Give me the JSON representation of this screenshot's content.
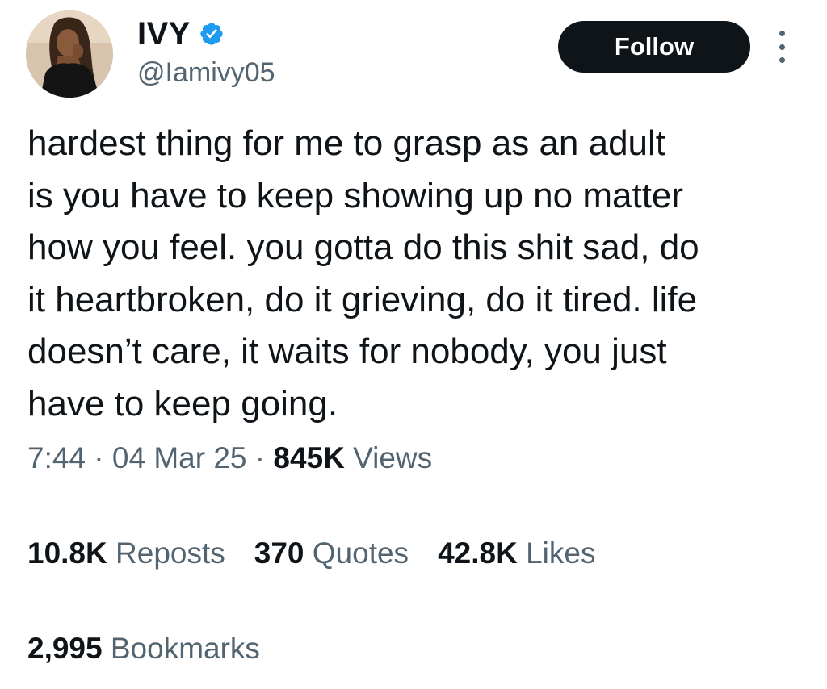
{
  "author": {
    "display_name": "IVY",
    "handle": "@Iamivy05",
    "verified_color": "#1d9bf0",
    "verified_icon": "verified-badge-icon",
    "avatar_icon": "profile-photo"
  },
  "actions": {
    "follow_label": "Follow",
    "more_icon": "more-vertical-icon"
  },
  "tweet": {
    "text": "hardest thing for me to grasp as an adult\nis you have to keep showing up no matter\nhow you feel. you gotta do this shit sad, do\nit heartbroken, do it grieving, do it tired. life\ndoesn’t care, it waits for nobody, you just\nhave to keep going."
  },
  "meta": {
    "time": "7:44",
    "separator": "·",
    "date": "04 Mar 25",
    "views_count": "845K",
    "views_label": "Views"
  },
  "stats": {
    "reposts_count": "10.8K",
    "reposts_label": "Reposts",
    "quotes_count": "370",
    "quotes_label": "Quotes",
    "likes_count": "42.8K",
    "likes_label": "Likes",
    "bookmarks_count": "2,995",
    "bookmarks_label": "Bookmarks"
  },
  "colors": {
    "text_primary": "#0f1419",
    "text_secondary": "#536471",
    "follow_bg": "#0f1419",
    "divider": "#dfe3e6"
  }
}
